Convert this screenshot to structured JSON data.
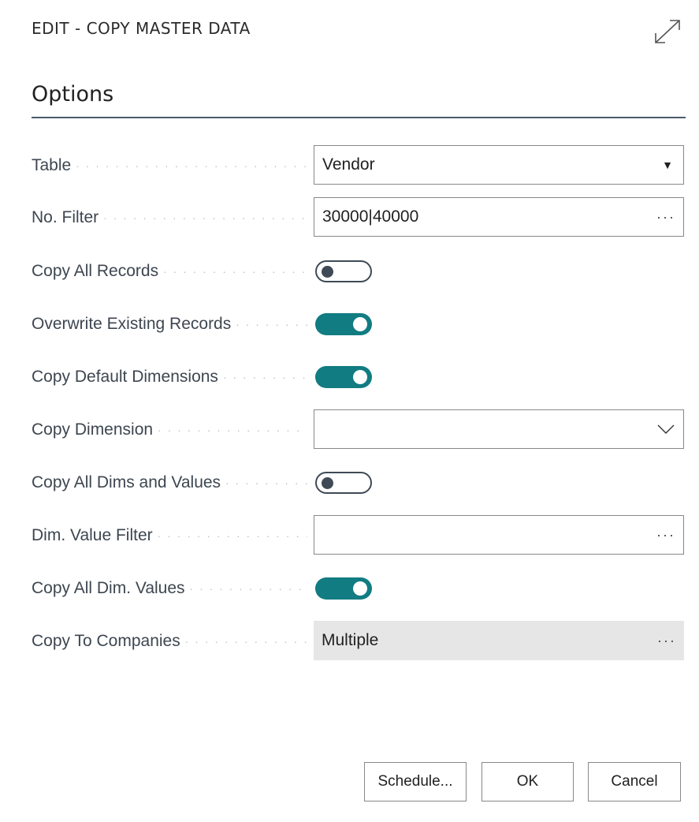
{
  "dialog": {
    "title": "EDIT - COPY MASTER DATA"
  },
  "section": {
    "title": "Options"
  },
  "fields": {
    "table": {
      "label": "Table",
      "value": "Vendor"
    },
    "no_filter": {
      "label": "No. Filter",
      "value": "30000|40000"
    },
    "copy_all_records": {
      "label": "Copy All Records",
      "state": "off"
    },
    "overwrite_existing": {
      "label": "Overwrite Existing Records",
      "state": "on"
    },
    "copy_default_dimensions": {
      "label": "Copy Default Dimensions",
      "state": "on"
    },
    "copy_dimension": {
      "label": "Copy Dimension",
      "value": ""
    },
    "copy_all_dims_values": {
      "label": "Copy All Dims and Values",
      "state": "off"
    },
    "dim_value_filter": {
      "label": "Dim. Value Filter",
      "value": ""
    },
    "copy_all_dim_values": {
      "label": "Copy All Dim. Values",
      "state": "on"
    },
    "copy_to_companies": {
      "label": "Copy To Companies",
      "value": "Multiple"
    }
  },
  "buttons": {
    "schedule": "Schedule...",
    "ok": "OK",
    "cancel": "Cancel"
  },
  "icons": {
    "expand": "expand-icon",
    "dropdown": "dropdown-arrow-icon",
    "chevron": "chevron-down-icon",
    "assist": "ellipsis-icon"
  },
  "colors": {
    "toggle_on": "#117c82",
    "toggle_off_border": "#3f4a56",
    "readonly_bg": "#e6e6e6",
    "rule": "#4a5b6c"
  }
}
